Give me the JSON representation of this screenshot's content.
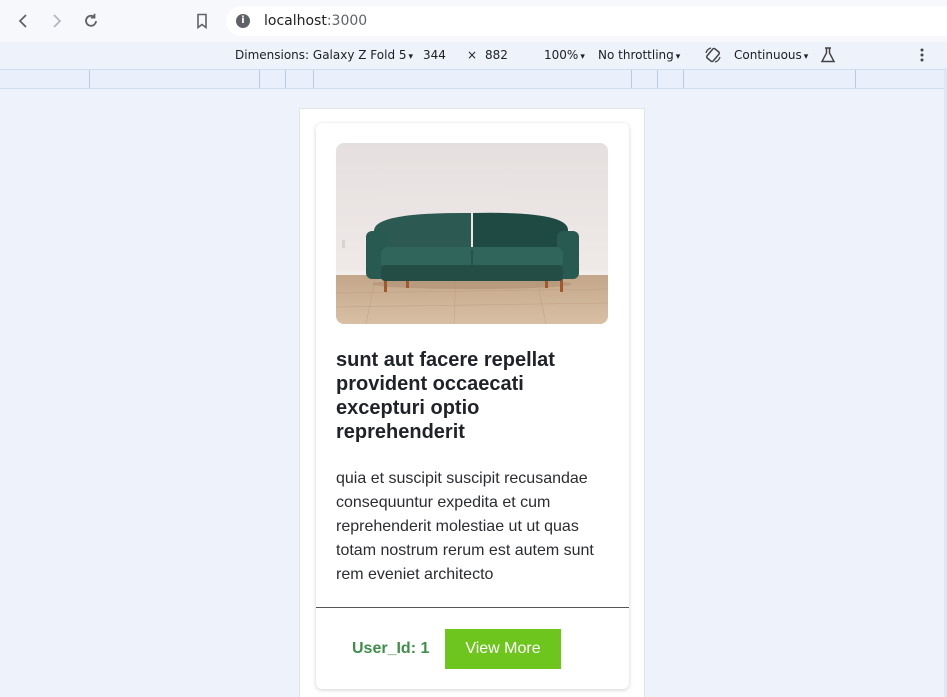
{
  "browser": {
    "url_host": "localhost",
    "url_port": ":3000",
    "site_info_glyph": "i"
  },
  "devtools": {
    "dimensions_label": "Dimensions: Galaxy Z Fold 5",
    "width": "344",
    "times": "×",
    "height": "882",
    "zoom": "100%",
    "throttling": "No throttling",
    "mode": "Continuous",
    "caret": "▾"
  },
  "card": {
    "title": "sunt aut facere repellat provident occaecati excepturi optio reprehenderit",
    "body": "quia et suscipit suscipit recusandae consequuntur expedita et cum reprehenderit molestiae ut ut quas totam nostrum rerum est autem sunt rem eveniet architecto",
    "user_id": "User_Id: 1",
    "view_more": "View More"
  },
  "colors": {
    "button": "#6dc51d",
    "user_id": "#3f8f4a",
    "page_bg": "#eef2fb"
  }
}
